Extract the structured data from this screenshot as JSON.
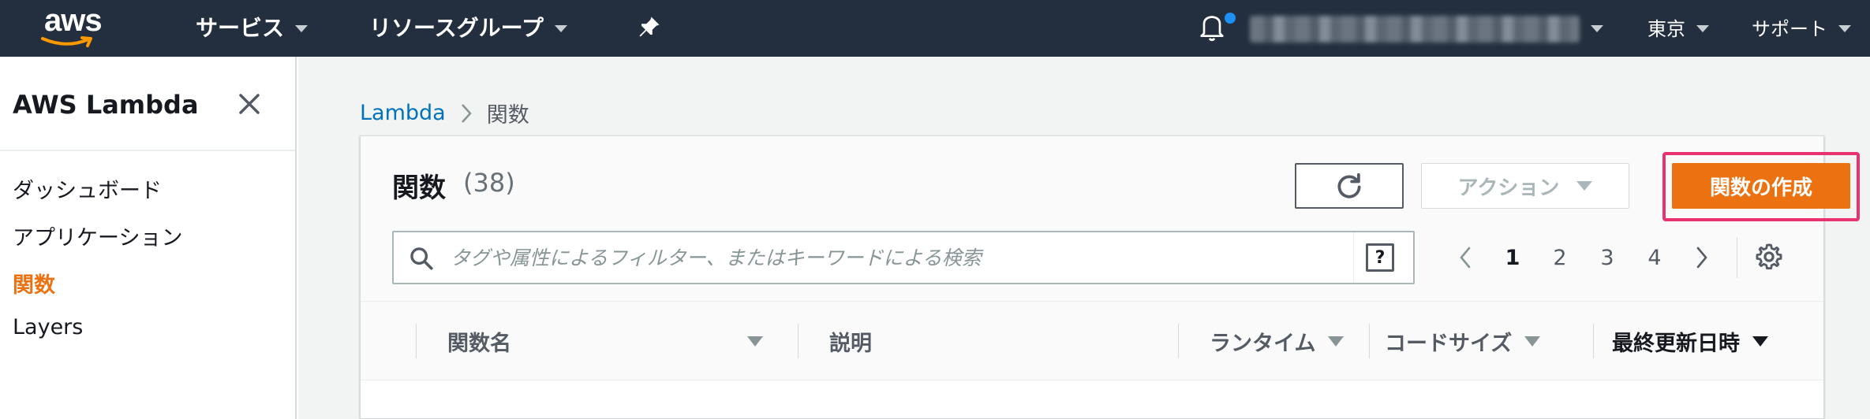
{
  "topnav": {
    "logo_text": "aws",
    "services_label": "サービス",
    "resource_groups_label": "リソースグループ",
    "region_label": "東京",
    "support_label": "サポート",
    "notification_color": "#1e8ff3"
  },
  "sidebar": {
    "title": "AWS Lambda",
    "items": [
      {
        "label": "ダッシュボード",
        "active": false
      },
      {
        "label": "アプリケーション",
        "active": false
      },
      {
        "label": "関数",
        "active": true
      },
      {
        "label": "Layers",
        "active": false
      }
    ]
  },
  "breadcrumb": {
    "root": "Lambda",
    "current": "関数"
  },
  "panel": {
    "title": "関数",
    "count": "(38)",
    "actions_label": "アクション",
    "create_label": "関数の作成",
    "search_placeholder": "タグや属性によるフィルター、またはキーワードによる検索",
    "help_label": "?",
    "pages": [
      "1",
      "2",
      "3",
      "4"
    ],
    "current_page": "1",
    "columns": [
      "関数名",
      "説明",
      "ランタイム",
      "コードサイズ",
      "最終更新日時"
    ]
  },
  "colors": {
    "nav_bg": "#232f3e",
    "accent_orange": "#ec7211",
    "link_blue": "#0073bb",
    "highlight_pink": "#e8336f"
  }
}
